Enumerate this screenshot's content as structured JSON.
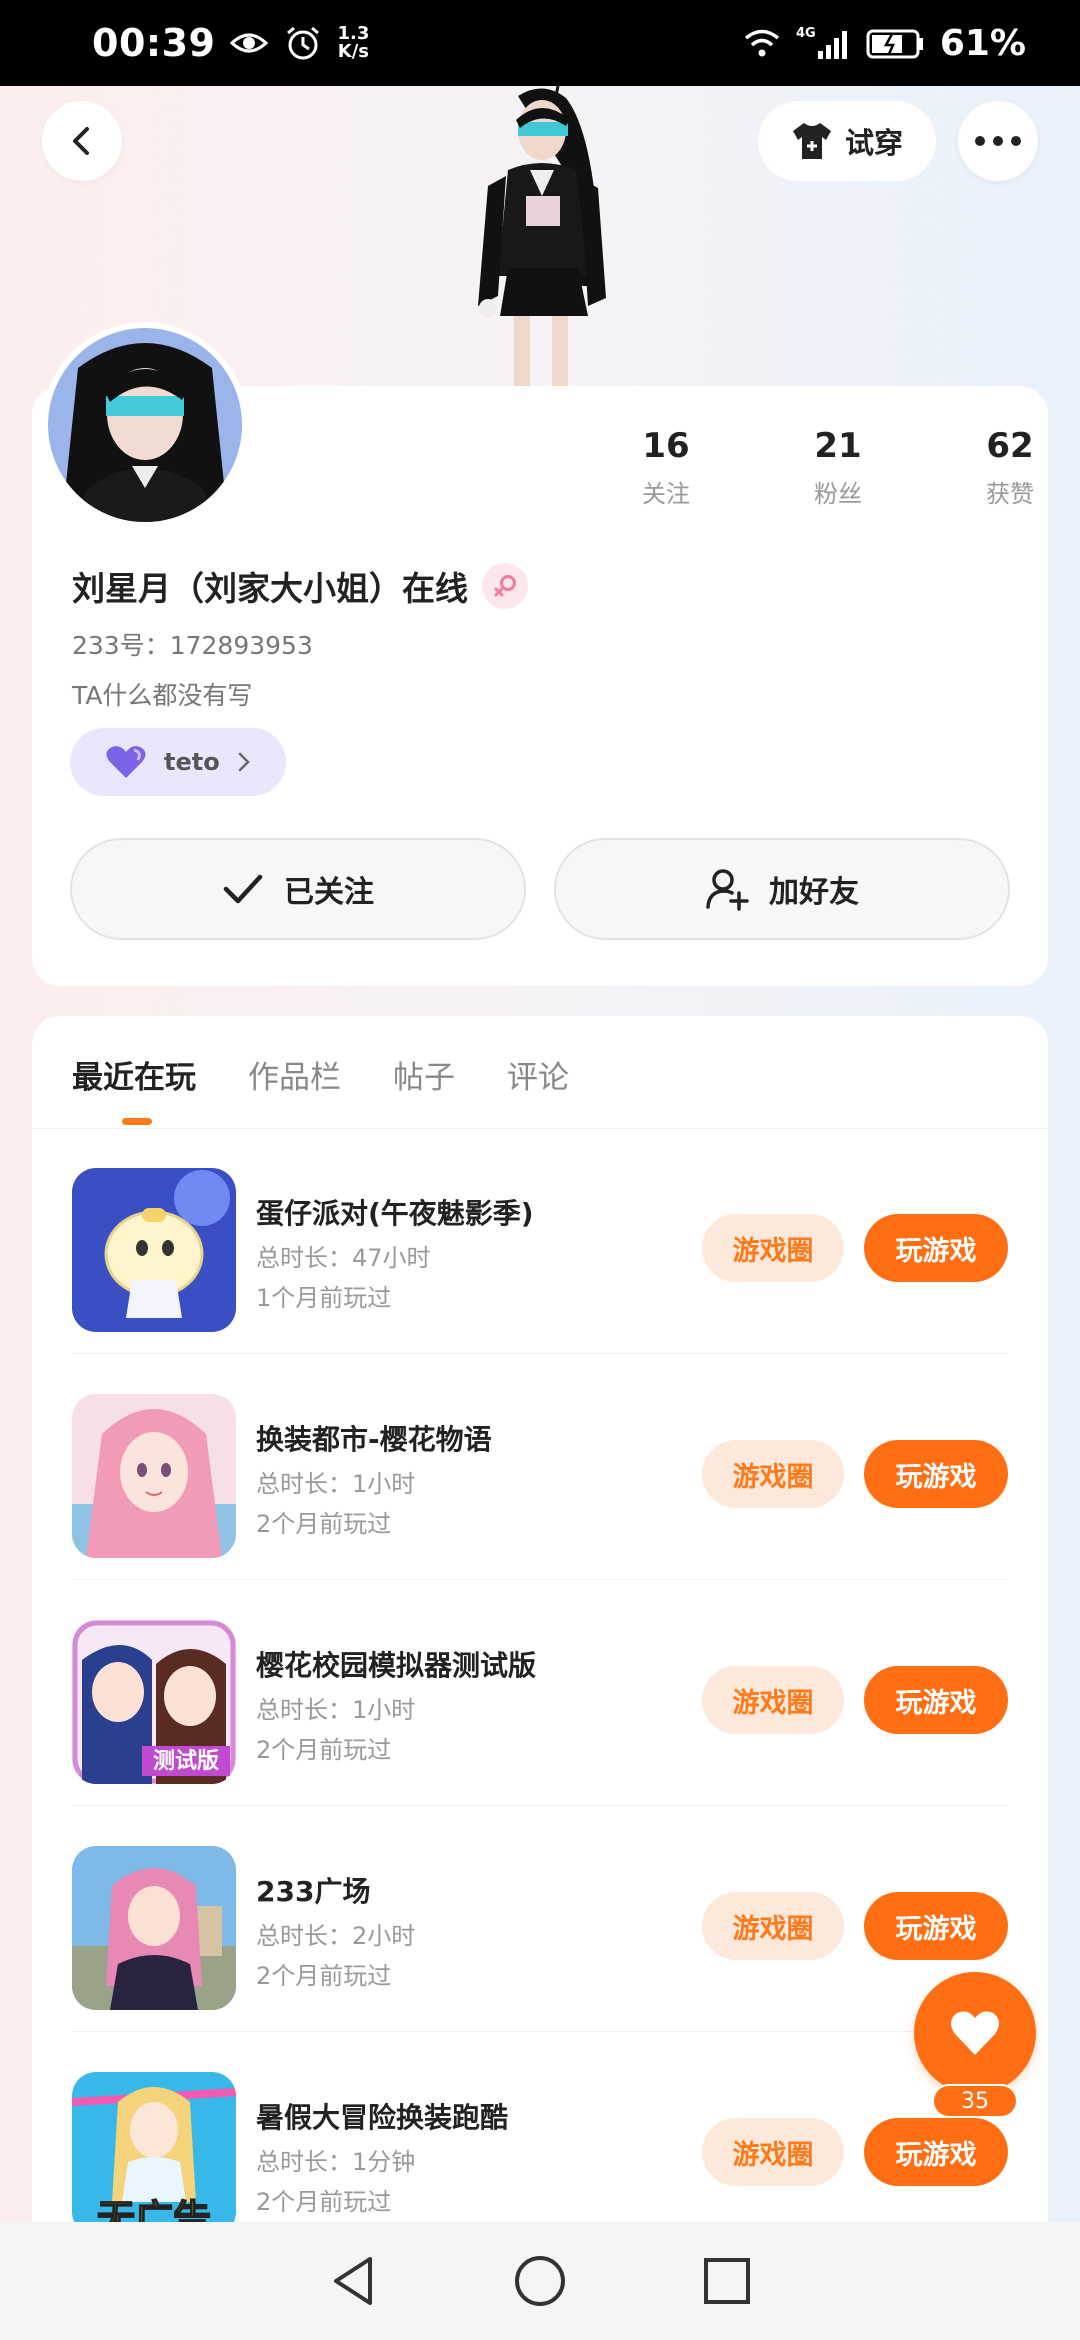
{
  "status_bar": {
    "time": "00:39",
    "speed_value": "1.3",
    "speed_unit": "K/s",
    "network": "4G",
    "battery": "61%"
  },
  "header": {
    "tryon_label": "试穿"
  },
  "profile": {
    "stats": [
      {
        "value": "16",
        "label": "关注"
      },
      {
        "value": "21",
        "label": "粉丝"
      },
      {
        "value": "62",
        "label": "获赞"
      }
    ],
    "name": "刘星月（刘家大小姐）在线",
    "id_text": "233号：172893953",
    "bio": "TA什么都没有写",
    "tag": "teto",
    "follow_label": "已关注",
    "add_friend_label": "加好友"
  },
  "tabs": [
    {
      "label": "最近在玩",
      "active": true
    },
    {
      "label": "作品栏",
      "active": false
    },
    {
      "label": "帖子",
      "active": false
    },
    {
      "label": "评论",
      "active": false
    }
  ],
  "games": [
    {
      "title": "蛋仔派对(午夜魅影季)",
      "duration": "总时长：47小时",
      "last_played": "1个月前玩过",
      "circle_label": "游戏圈",
      "play_label": "玩游戏"
    },
    {
      "title": "换装都市-樱花物语",
      "duration": "总时长：1小时",
      "last_played": "2个月前玩过",
      "circle_label": "游戏圈",
      "play_label": "玩游戏"
    },
    {
      "title": "樱花校园模拟器测试版",
      "duration": "总时长：1小时",
      "last_played": "2个月前玩过",
      "circle_label": "游戏圈",
      "play_label": "玩游戏"
    },
    {
      "title": "233广场",
      "duration": "总时长：2小时",
      "last_played": "2个月前玩过",
      "circle_label": "游戏圈",
      "play_label": "玩游戏"
    },
    {
      "title": "暑假大冒险换装跑酷",
      "duration": "总时长：1分钟",
      "last_played": "2个月前玩过",
      "circle_label": "游戏圈",
      "play_label": "玩游戏"
    }
  ],
  "game_icon_text": {
    "icon_3_badge": "测试版",
    "icon_5_badge": "无广告"
  },
  "like": {
    "count": "35"
  },
  "colors": {
    "accent": "#ff6e12",
    "accent_light": "#fde9dc",
    "tag_bg": "#e9e6fd"
  }
}
